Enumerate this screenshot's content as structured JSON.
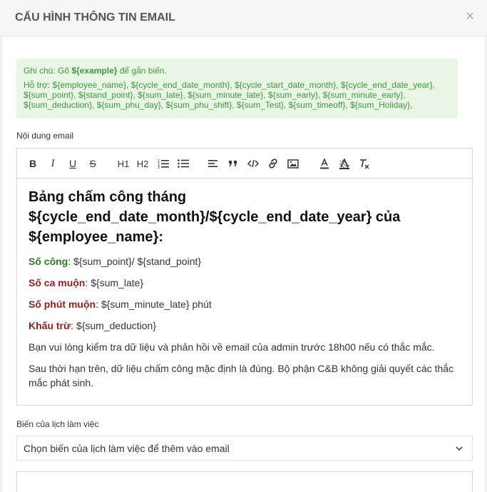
{
  "modal": {
    "title": "CẤU HÌNH THÔNG TIN EMAIL",
    "close_symbol": "×"
  },
  "note": {
    "prefix": "Ghi chú: Gõ ",
    "example": "${example}",
    "suffix": " để gắn biến.",
    "support_line": "Hỗ trợ: ${employee_name}, ${cycle_end_date_month}, ${cycle_start_date_month}, ${cycle_end_date_year}, ${sum_point}, ${stand_point}, ${sum_late}, ${sum_minute_late}, ${sum_early}, ${sum_minute_early}, ${sum_deduction}, ${sum_phu_day}, ${sum_phu_shift}, ${sum_Test}, ${sum_timeoff}, ${sum_Holiday},"
  },
  "email_content": {
    "label": "Nội dung email",
    "toolbar": {
      "bold": "B",
      "italic": "I",
      "underline": "U",
      "strike": "S",
      "h1": "H1",
      "h2": "H2",
      "icons": [
        "ordered-list-icon",
        "bullet-list-icon",
        "align-icon",
        "quote-icon",
        "code-icon",
        "link-icon",
        "image-icon",
        "text-color-icon",
        "background-color-icon",
        "clear-format-icon"
      ]
    },
    "heading": "Bảng chấm công tháng ${cycle_end_date_month}/${cycle_end_date_year} của ${employee_name}:",
    "rows": [
      {
        "label": "Số công",
        "value": ": ${sum_point}/ ${stand_point}"
      },
      {
        "label": "Số ca muộn",
        "value": ": ${sum_late}"
      },
      {
        "label": "Số phút muộn",
        "value": ": ${sum_minute_late} phút"
      },
      {
        "label": "Khấu trừ",
        "value": ": ${sum_deduction}"
      }
    ],
    "paragraph1": "Bạn vui lòng kiểm tra dữ liệu và phản hồi về email của admin trước 18h00 nếu có thắc mắc.",
    "paragraph2": "Sau thời hạn trên, dữ liệu chấm công mặc định là đúng. Bộ phận C&B không giải quyết các thắc mắc phát sinh."
  },
  "schedule_vars": {
    "label": "Biến của lịch làm việc",
    "select_value": "Chọn biến của lịch làm việc để thêm vào email"
  },
  "colors": {
    "note_bg": "#e9f6e6",
    "note_text": "#3c9a3a",
    "label_green": "#2e7d1e",
    "label_red": "#9b1b1b"
  }
}
